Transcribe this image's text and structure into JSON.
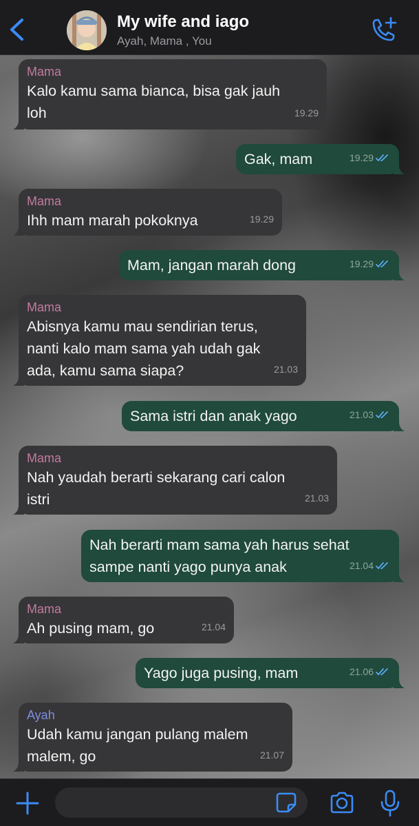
{
  "header": {
    "title": "My wife and iago",
    "subtitle": "Ayah, Mama , You"
  },
  "messages": [
    {
      "direction": "in",
      "sender": "Mama",
      "lines": [
        "Kalo kamu sama bianca, bisa gak jauh",
        "loh"
      ],
      "time": "19.29"
    },
    {
      "direction": "out",
      "lines": [
        "Gak, mam"
      ],
      "time": "19.29",
      "status": "read"
    },
    {
      "direction": "in",
      "sender": "Mama",
      "lines": [
        "Ihh mam marah pokoknya"
      ],
      "time": "19.29"
    },
    {
      "direction": "out",
      "lines": [
        "Mam, jangan marah dong"
      ],
      "time": "19.29",
      "status": "read"
    },
    {
      "direction": "in",
      "sender": "Mama",
      "lines": [
        "Abisnya kamu mau sendirian terus,",
        "nanti kalo mam sama yah udah gak",
        "ada, kamu sama siapa?"
      ],
      "time": "21.03"
    },
    {
      "direction": "out",
      "lines": [
        "Sama istri dan anak yago"
      ],
      "time": "21.03",
      "status": "read"
    },
    {
      "direction": "in",
      "sender": "Mama",
      "lines": [
        "Nah yaudah berarti sekarang cari calon",
        "istri"
      ],
      "time": "21.03"
    },
    {
      "direction": "out",
      "lines": [
        "Nah berarti mam sama yah harus sehat",
        "sampe nanti yago punya anak"
      ],
      "time": "21.04",
      "status": "read"
    },
    {
      "direction": "in",
      "sender": "Mama",
      "lines": [
        "Ah pusing mam, go"
      ],
      "time": "21.04"
    },
    {
      "direction": "out",
      "lines": [
        "Yago juga pusing, mam"
      ],
      "time": "21.06",
      "status": "read"
    },
    {
      "direction": "in",
      "sender": "Ayah",
      "lines": [
        "Udah kamu jangan pulang malem",
        "malem, go"
      ],
      "time": "21.07"
    }
  ],
  "colors": {
    "accent": "#3b8cf6",
    "incoming_bubble": "#363638",
    "outgoing_bubble": "#1f4a3c",
    "sender_mama": "#c37ba0",
    "sender_ayah": "#7f8ee2",
    "read_ticks": "#5aa9f0"
  },
  "icons": {
    "back": "chevron-left-icon",
    "call": "phone-plus-icon",
    "attach": "plus-icon",
    "sticker": "sticker-icon",
    "camera": "camera-icon",
    "mic": "microphone-icon"
  }
}
